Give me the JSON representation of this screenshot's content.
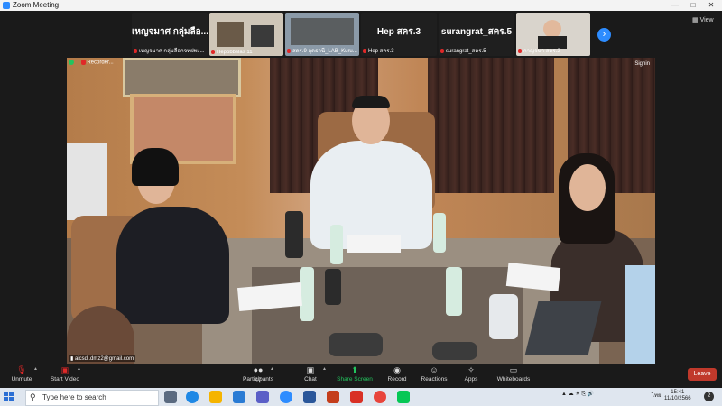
{
  "window": {
    "title": "Zoom Meeting"
  },
  "thumbnails": [
    {
      "big": "เหญจมาศ กลุ่มลือ...",
      "name": "เหญจมาศ กลุ่มลือกจทฝพง..."
    },
    {
      "big": "",
      "name": "Hepobbslas 11"
    },
    {
      "big": "",
      "name": "สดร.9 อุดธานี_LAB_Kuru..."
    },
    {
      "big": "Hep สคร.3",
      "name": "Hep สคร.3"
    },
    {
      "big": "surangrat_สคร.5",
      "name": "surangrat_สคร.5"
    },
    {
      "big": "",
      "name": "กาญจนา สคร.2"
    }
  ],
  "view_button": "View",
  "speaker": {
    "top_left_name": "Recorder...",
    "top_right": "Signin",
    "name_label": "aicsdi.dmz2@gmail.com"
  },
  "toolbar": {
    "unmute": "Unmute",
    "start_video": "Start Video",
    "participants": "Participants",
    "participants_count": "47",
    "chat": "Chat",
    "share_screen": "Share Screen",
    "record": "Record",
    "reactions": "Reactions",
    "apps": "Apps",
    "whiteboards": "Whiteboards",
    "leave": "Leave"
  },
  "taskbar": {
    "search_placeholder": "Type here to search",
    "lang": "ไทย",
    "time": "15:41",
    "date": "11/10/2566",
    "notif": "2"
  },
  "colors": {
    "zoom_blue": "#2d8cff",
    "leave_red": "#c0392b",
    "share_green": "#22c55e"
  }
}
